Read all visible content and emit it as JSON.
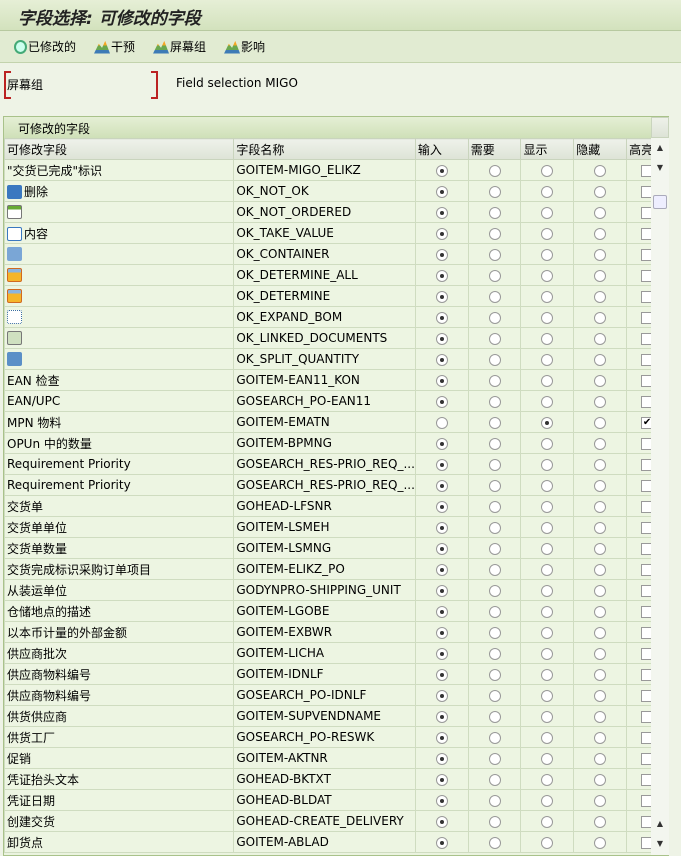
{
  "title": "字段选择: 可修改的字段",
  "toolbar": [
    {
      "label": "已修改的",
      "icon": "magnifier-icon"
    },
    {
      "label": "干预",
      "icon": "mountain-icon"
    },
    {
      "label": "屏幕组",
      "icon": "mountain-icon"
    },
    {
      "label": "影响",
      "icon": "mountain-icon"
    }
  ],
  "field": {
    "label": "屏幕组",
    "value": "Field selection MIGO"
  },
  "group_title": "可修改的字段",
  "columns": [
    "可修改字段",
    "字段名称",
    "输入",
    "需要",
    "显示",
    "隐藏",
    "高亮"
  ],
  "rows": [
    {
      "label": "\"交货已完成\"标识",
      "field": "GOITEM-MIGO_ELIKZ",
      "sel": "输入",
      "hl": false
    },
    {
      "label": "删除",
      "icon": "trash-icon",
      "field": "OK_NOT_OK",
      "sel": "输入",
      "hl": false
    },
    {
      "label": "",
      "icon": "add-row-icon",
      "field": "OK_NOT_ORDERED",
      "sel": "输入",
      "hl": false
    },
    {
      "label": "内容",
      "icon": "document-copy-icon",
      "field": "OK_TAKE_VALUE",
      "sel": "输入",
      "hl": false
    },
    {
      "label": "",
      "icon": "container-icon",
      "field": "OK_CONTAINER",
      "sel": "输入",
      "hl": false
    },
    {
      "label": "",
      "icon": "warehouse-icon",
      "field": "OK_DETERMINE_ALL",
      "sel": "输入",
      "hl": false
    },
    {
      "label": "",
      "icon": "warehouse-icon",
      "field": "OK_DETERMINE",
      "sel": "输入",
      "hl": false
    },
    {
      "label": "",
      "icon": "hierarchy-icon",
      "field": "OK_EXPAND_BOM",
      "sel": "输入",
      "hl": false
    },
    {
      "label": "",
      "icon": "linked-documents-icon",
      "field": "OK_LINKED_DOCUMENTS",
      "sel": "输入",
      "hl": false
    },
    {
      "label": "",
      "icon": "split-icon",
      "field": "OK_SPLIT_QUANTITY",
      "sel": "输入",
      "hl": false
    },
    {
      "label": "EAN 检查",
      "field": "GOITEM-EAN11_KON",
      "sel": "输入",
      "hl": false
    },
    {
      "label": "EAN/UPC",
      "field": "GOSEARCH_PO-EAN11",
      "sel": "输入",
      "hl": false
    },
    {
      "label": "MPN 物料",
      "field": "GOITEM-EMATN",
      "sel": "显示",
      "hl": true
    },
    {
      "label": "OPUn 中的数量",
      "field": "GOITEM-BPMNG",
      "sel": "输入",
      "hl": false
    },
    {
      "label": "Requirement Priority",
      "field": "GOSEARCH_RES-PRIO_REQ_...",
      "sel": "输入",
      "hl": false
    },
    {
      "label": "Requirement Priority",
      "field": "GOSEARCH_RES-PRIO_REQ_...",
      "sel": "输入",
      "hl": false
    },
    {
      "label": "交货单",
      "field": "GOHEAD-LFSNR",
      "sel": "输入",
      "hl": false
    },
    {
      "label": "交货单单位",
      "field": "GOITEM-LSMEH",
      "sel": "输入",
      "hl": false
    },
    {
      "label": "交货单数量",
      "field": "GOITEM-LSMNG",
      "sel": "输入",
      "hl": false
    },
    {
      "label": "交货完成标识采购订单项目",
      "field": "GOITEM-ELIKZ_PO",
      "sel": "输入",
      "hl": false
    },
    {
      "label": "从装运单位",
      "field": "GODYNPRO-SHIPPING_UNIT",
      "sel": "输入",
      "hl": false
    },
    {
      "label": "仓储地点的描述",
      "field": "GOITEM-LGOBE",
      "sel": "输入",
      "hl": false
    },
    {
      "label": "以本币计量的外部金额",
      "field": "GOITEM-EXBWR",
      "sel": "输入",
      "hl": false
    },
    {
      "label": "供应商批次",
      "field": "GOITEM-LICHA",
      "sel": "输入",
      "hl": false
    },
    {
      "label": "供应商物料编号",
      "field": "GOITEM-IDNLF",
      "sel": "输入",
      "hl": false
    },
    {
      "label": "供应商物料编号",
      "field": "GOSEARCH_PO-IDNLF",
      "sel": "输入",
      "hl": false
    },
    {
      "label": "供货供应商",
      "field": "GOITEM-SUPVENDNAME",
      "sel": "输入",
      "hl": false
    },
    {
      "label": "供货工厂",
      "field": "GOSEARCH_PO-RESWK",
      "sel": "输入",
      "hl": false
    },
    {
      "label": "促销",
      "field": "GOITEM-AKTNR",
      "sel": "输入",
      "hl": false
    },
    {
      "label": "凭证抬头文本",
      "field": "GOHEAD-BKTXT",
      "sel": "输入",
      "hl": false
    },
    {
      "label": "凭证日期",
      "field": "GOHEAD-BLDAT",
      "sel": "输入",
      "hl": false
    },
    {
      "label": "创建交货",
      "field": "GOHEAD-CREATE_DELIVERY",
      "sel": "输入",
      "hl": false
    },
    {
      "label": "卸货点",
      "field": "GOITEM-ABLAD",
      "sel": "输入",
      "hl": false
    }
  ]
}
